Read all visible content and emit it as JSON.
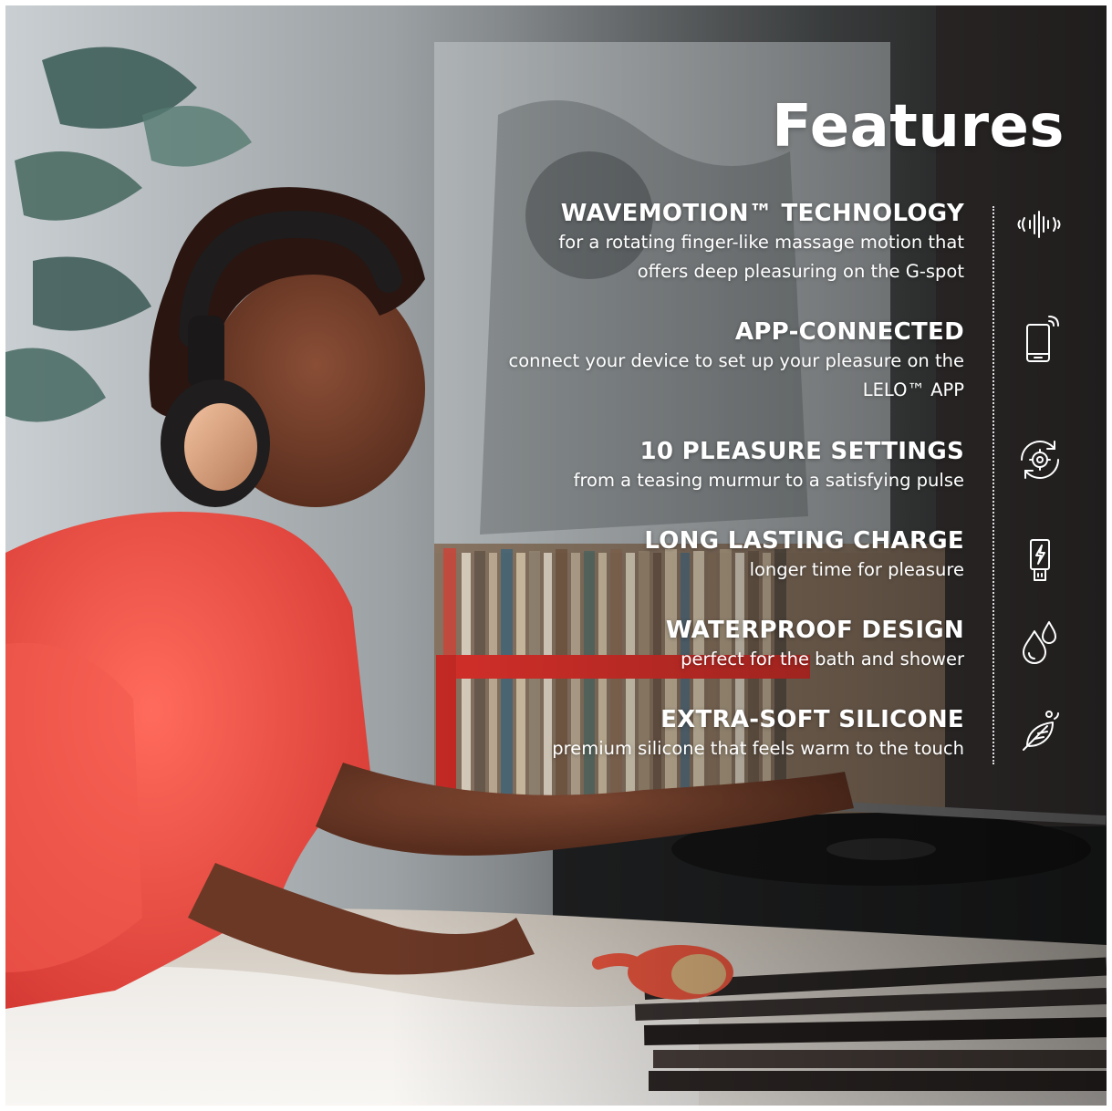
{
  "title": "Features",
  "colors": {
    "text": "#ffffff",
    "shirt": "#ee4a45",
    "accent_red": "#d8302a"
  },
  "features": [
    {
      "title": "WAVEMOTION™ TECHNOLOGY",
      "desc_lines": [
        "for a rotating finger-like massage motion that",
        "offers deep pleasuring on the G-spot"
      ],
      "icon": "wave-motion-icon"
    },
    {
      "title": "APP-CONNECTED",
      "desc_lines": [
        "connect your device to set up your pleasure on the",
        "LELO™ APP"
      ],
      "icon": "smartphone-signal-icon"
    },
    {
      "title": "10 PLEASURE SETTINGS",
      "desc_lines": [
        "from a teasing murmur to a satisfying pulse"
      ],
      "icon": "settings-cycle-icon"
    },
    {
      "title": "LONG LASTING CHARGE",
      "desc_lines": [
        "longer time for pleasure"
      ],
      "icon": "usb-charge-icon"
    },
    {
      "title": "WATERPROOF DESIGN",
      "desc_lines": [
        "perfect for the bath and shower"
      ],
      "icon": "water-drops-icon"
    },
    {
      "title": "EXTRA-SOFT SILICONE",
      "desc_lines": [
        "premium silicone that feels warm to the touch"
      ],
      "icon": "feather-icon"
    }
  ]
}
